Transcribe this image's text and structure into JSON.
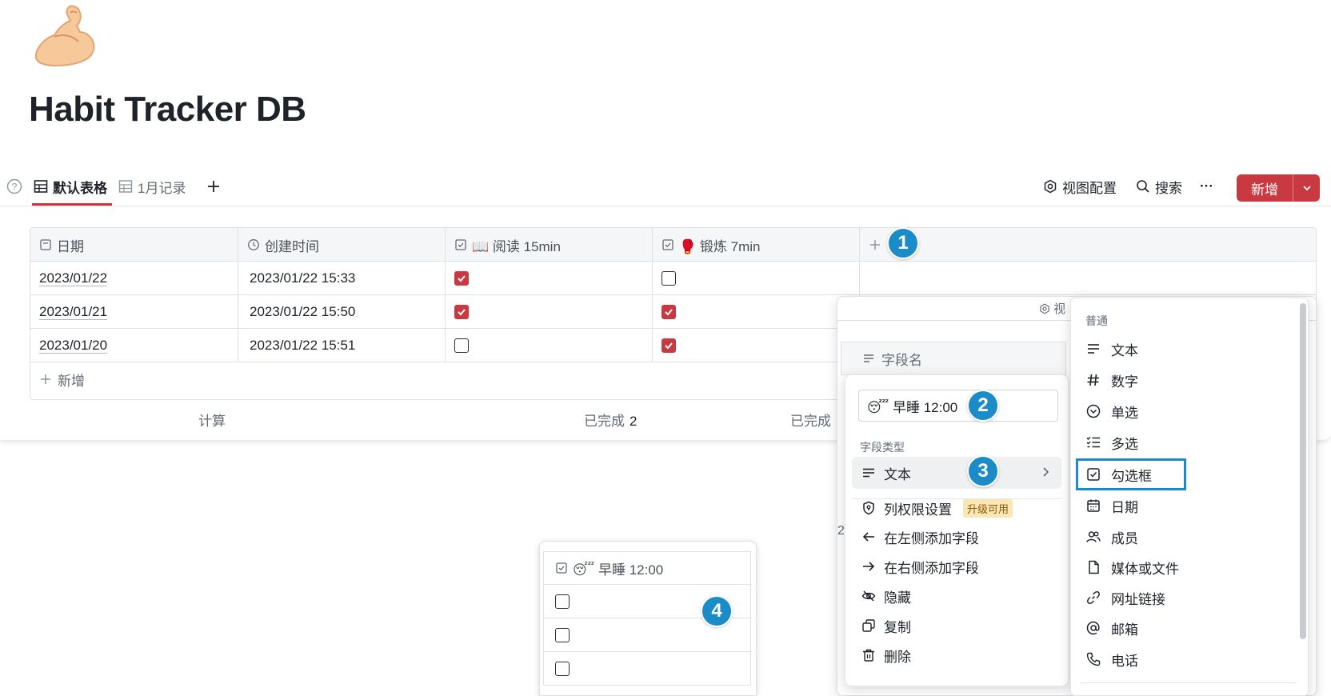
{
  "page": {
    "icon": "flexed-biceps-emoji",
    "title": "Habit Tracker DB"
  },
  "toolbar": {
    "tabs": [
      {
        "label": "默认表格",
        "icon": "table-icon",
        "active": true
      },
      {
        "label": "1月记录",
        "icon": "table-icon",
        "active": false
      }
    ],
    "view_config": "视图配置",
    "search": "搜索",
    "more": "···",
    "new_button": "新增"
  },
  "table": {
    "columns": [
      {
        "label": "日期",
        "icon": "text-field-icon"
      },
      {
        "label": "创建时间",
        "icon": "clock-icon"
      },
      {
        "label": "📖 阅读 15min",
        "icon": "checkbox-field-icon"
      },
      {
        "label": "🥊 锻炼 7min",
        "icon": "checkbox-field-icon"
      }
    ],
    "rows": [
      {
        "date": "2023/01/22",
        "created": "2023/01/22 15:33",
        "read": true,
        "exercise": false
      },
      {
        "date": "2023/01/21",
        "created": "2023/01/22 15:50",
        "read": true,
        "exercise": true
      },
      {
        "date": "2023/01/20",
        "created": "2023/01/22 15:51",
        "read": false,
        "exercise": true
      }
    ],
    "add_row": "新增",
    "summary": {
      "calc_label": "计算",
      "read_done_label": "已完成",
      "read_done_value": "2",
      "exercise_done_label": "已完成"
    }
  },
  "badges": [
    "1",
    "2",
    "3",
    "4"
  ],
  "back_panel": {
    "snippet": "视",
    "field_name_header": "字段名",
    "partial_digit": "2"
  },
  "field_editor": {
    "name_value": "😴 早睡 12:00",
    "type_section": "字段类型",
    "current_type": "文本",
    "menu": [
      {
        "label": "列权限设置",
        "icon": "shield-icon",
        "tag": "升级可用"
      },
      {
        "label": "在左侧添加字段",
        "icon": "arrow-left-icon"
      },
      {
        "label": "在右侧添加字段",
        "icon": "arrow-right-icon"
      },
      {
        "label": "隐藏",
        "icon": "eye-off-icon"
      },
      {
        "label": "复制",
        "icon": "copy-icon"
      },
      {
        "label": "删除",
        "icon": "trash-icon"
      }
    ]
  },
  "type_menu": {
    "section": "普通",
    "items": [
      {
        "label": "文本",
        "icon": "text-lines-icon"
      },
      {
        "label": "数字",
        "icon": "hash-icon"
      },
      {
        "label": "单选",
        "icon": "single-select-icon"
      },
      {
        "label": "多选",
        "icon": "multi-select-icon"
      },
      {
        "label": "勾选框",
        "icon": "checkbox-icon",
        "highlighted": true
      },
      {
        "label": "日期",
        "icon": "calendar-icon"
      },
      {
        "label": "成员",
        "icon": "users-icon"
      },
      {
        "label": "媒体或文件",
        "icon": "file-icon"
      },
      {
        "label": "网址链接",
        "icon": "link-icon"
      },
      {
        "label": "邮箱",
        "icon": "at-icon"
      },
      {
        "label": "电话",
        "icon": "phone-icon"
      }
    ]
  },
  "mini_column": {
    "header": "😴 早睡 12:00",
    "rows": [
      false,
      false,
      false
    ]
  },
  "colors": {
    "accent": "#c93942",
    "badge": "#1b8cc8",
    "upgrade_tag": "#fbe7b6"
  }
}
